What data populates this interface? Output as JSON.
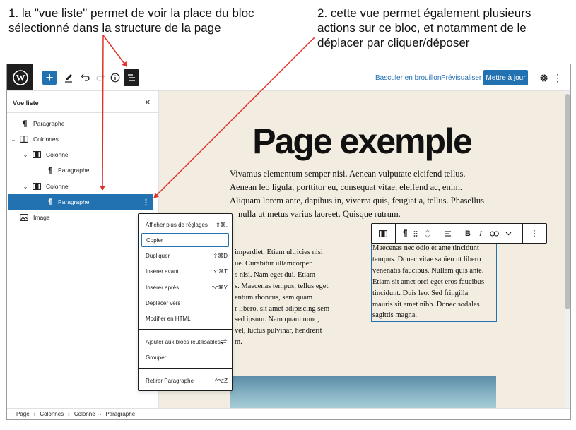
{
  "annotations": {
    "note1_line1": "1. la \"vue liste\" permet de voir la place du bloc",
    "note1_line2": "sélectionné dans la structure de la page",
    "note2_line1": "2. cette vue permet également plusieurs",
    "note2_line2": "actions sur ce bloc, et notamment de le",
    "note2_line3": "déplacer par cliquer/déposer",
    "arrow_color": "#e0312a"
  },
  "toolbar": {
    "inserter": "+",
    "draft_link": "Basculer en brouillon",
    "preview_link": "Prévisualiser",
    "update_button": "Mettre à jour",
    "more": "⋮",
    "accent": "#2271b1"
  },
  "list_view": {
    "title": "Vue liste",
    "close": "×",
    "kebab": "⋮",
    "items": [
      {
        "label": "Paragraphe",
        "icon": "paragraph-icon",
        "level": 1
      },
      {
        "label": "Colonnes",
        "icon": "columns-icon",
        "level": 1,
        "expanded": true
      },
      {
        "label": "Colonne",
        "icon": "column-icon",
        "level": 2,
        "expanded": true
      },
      {
        "label": "Paragraphe",
        "icon": "paragraph-icon",
        "level": 3
      },
      {
        "label": "Colonne",
        "icon": "column-icon",
        "level": 2,
        "expanded": true
      },
      {
        "label": "Paragraphe",
        "icon": "paragraph-icon",
        "level": 3,
        "selected": true
      },
      {
        "label": "Image",
        "icon": "image-icon",
        "level": 1
      }
    ]
  },
  "canvas": {
    "background": "#f2ede0",
    "title": "Page exemple",
    "intro_lines": [
      "Vivamus elementum semper nisi. Aenean vulputate eleifend tellus.",
      "Aenean leo ligula, porttitor eu, consequat vitae, eleifend ac, enim.",
      "Aliquam lorem ante, dapibus in, viverra quis, feugiat a, tellus. Phasellus",
      "nulla ut metus varius laoreet. Quisque rutrum."
    ],
    "left_column_lines": [
      "imperdiet. Etiam ultricies nisi",
      "ue. Curabitur ullamcorper",
      "s nisi. Nam eget dui. Etiam",
      "s. Maecenas tempus, tellus eget",
      "entum rhoncus, sem quam",
      "r libero, sit amet adipiscing sem",
      "sed ipsum. Nam quam nunc,",
      "vel, luctus pulvinar, hendrerit",
      "m."
    ],
    "right_column_lines": [
      "Maecenas nec odio et ante tincidunt",
      "tempus. Donec vitae sapien ut libero",
      "venenatis faucibus. Nullam quis ante.",
      "Etiam sit amet orci eget eros faucibus",
      "tincidunt. Duis leo. Sed fringilla",
      "mauris sit amet nibh. Donec sodales",
      "sagittis magna."
    ]
  },
  "block_toolbar": {
    "bold": "B",
    "italic": "I",
    "options": "⋮"
  },
  "context_menu": {
    "items": [
      {
        "label": "Afficher plus de réglages",
        "shortcut": "⇧⌘,"
      },
      {
        "label": "Copier",
        "shortcut": "",
        "focused": true
      },
      {
        "label": "Dupliquer",
        "shortcut": "⇧⌘D"
      },
      {
        "label": "Insérer avant",
        "shortcut": "⌥⌘T"
      },
      {
        "label": "Insérer après",
        "shortcut": "⌥⌘Y"
      },
      {
        "label": "Déplacer vers",
        "shortcut": ""
      },
      {
        "label": "Modifier en HTML",
        "shortcut": ""
      },
      {
        "label": "Ajouter aux blocs réutilisables",
        "shortcut": "",
        "icon": "reusable-icon"
      },
      {
        "label": "Grouper",
        "shortcut": ""
      },
      {
        "label": "Retirer Paragraphe",
        "shortcut": "^⌥Z"
      }
    ]
  },
  "breadcrumb": [
    "Page",
    "Colonnes",
    "Colonne",
    "Paragraphe"
  ],
  "breadcrumb_separator": "›"
}
